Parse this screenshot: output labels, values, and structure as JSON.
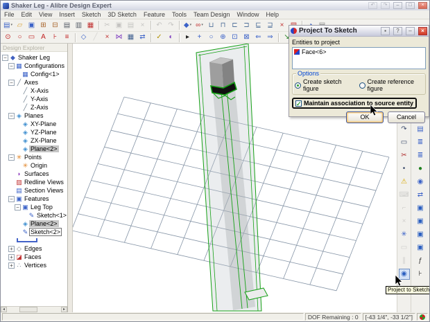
{
  "window": {
    "title": "Shaker Leg - Alibre Design Expert",
    "buttons": {
      "back": "↶",
      "forward": "↷",
      "minimize": "–",
      "maximize": "□",
      "close": "×"
    }
  },
  "menu": {
    "items": [
      "File",
      "Edit",
      "View",
      "Insert",
      "Sketch",
      "3D Sketch",
      "Feature",
      "Tools",
      "Team Design",
      "Window",
      "Help"
    ]
  },
  "toolbars": {
    "row1": [
      [
        {
          "name": "new-part-button",
          "glyph": "▤",
          "color": "#3b62c8",
          "dropdown": true
        },
        {
          "name": "open-button",
          "glyph": "▱",
          "color": "#d9a33c"
        },
        {
          "name": "save-button",
          "glyph": "▣",
          "color": "#3b62c8"
        },
        {
          "name": "import-button",
          "glyph": "⊞",
          "color": "#a8652c"
        },
        {
          "name": "export-button",
          "glyph": "⊟",
          "color": "#a8652c"
        },
        {
          "name": "print-button",
          "glyph": "▤",
          "color": "#555c66"
        },
        {
          "name": "print-preview-button",
          "glyph": "▥",
          "color": "#555c66"
        },
        {
          "name": "publish-report-button",
          "glyph": "▦",
          "color": "#c03030"
        }
      ],
      [
        {
          "name": "cut-button",
          "glyph": "✂",
          "color": "#666",
          "disabled": true
        },
        {
          "name": "copy-button",
          "glyph": "▣",
          "color": "#666",
          "disabled": true
        },
        {
          "name": "paste-button",
          "glyph": "▤",
          "color": "#666",
          "disabled": true
        },
        {
          "name": "delete-button",
          "glyph": "×",
          "color": "#666",
          "disabled": true
        }
      ],
      [
        {
          "name": "undo-button",
          "glyph": "↶",
          "color": "#666",
          "disabled": true
        },
        {
          "name": "redo-button",
          "glyph": "↷",
          "color": "#666",
          "disabled": true
        }
      ],
      [
        {
          "name": "view-cube-button",
          "glyph": "◆",
          "color": "#3b62c8",
          "dropdown": true
        },
        {
          "name": "measure-button",
          "glyph": "∞",
          "color": "#c03030",
          "dropdown": true
        },
        {
          "name": "view-orientation-front-button",
          "glyph": "⊔",
          "color": "#50709a"
        },
        {
          "name": "view-orientation-back-button",
          "glyph": "⊓",
          "color": "#50709a"
        },
        {
          "name": "view-orientation-left-button",
          "glyph": "⊏",
          "color": "#50709a"
        },
        {
          "name": "view-orientation-right-button",
          "glyph": "⊐",
          "color": "#50709a"
        },
        {
          "name": "view-orientation-top-button",
          "glyph": "⊑",
          "color": "#50709a"
        },
        {
          "name": "view-orientation-bottom-button",
          "glyph": "⊒",
          "color": "#50709a"
        },
        {
          "name": "remove-view-button",
          "glyph": "×",
          "color": "#c03030"
        },
        {
          "name": "annotation-views-button",
          "glyph": "▨",
          "color": "#c03030"
        }
      ],
      [
        {
          "name": "design-explorer-toggle-button",
          "glyph": "◑",
          "color": "#3b62c8"
        },
        {
          "name": "options-button",
          "glyph": "▤",
          "color": "#888"
        }
      ]
    ],
    "row2": [
      [
        {
          "name": "sketch-select-tool",
          "glyph": "⊙",
          "color": "#c02020"
        },
        {
          "name": "ellipse-tool",
          "glyph": "○",
          "color": "#c02020"
        },
        {
          "name": "rectangle-annotation-tool",
          "glyph": "▭",
          "color": "#c02020"
        },
        {
          "name": "text-tool",
          "glyph": "A",
          "color": "#c02020"
        },
        {
          "name": "dimension-annotation-tool",
          "glyph": "⊦",
          "color": "#c02020"
        },
        {
          "name": "line-format-tool",
          "glyph": "≡",
          "color": "#c02020"
        }
      ],
      [
        {
          "name": "insert-plane-button",
          "glyph": "◇",
          "color": "#3b62c8"
        },
        {
          "name": "insert-axis-button",
          "glyph": "╱",
          "color": "#999",
          "disabled": true
        },
        {
          "name": "erase-tool",
          "glyph": "×",
          "color": "#c03030"
        },
        {
          "name": "mirror-tool",
          "glyph": "⋈",
          "color": "#8040c0"
        },
        {
          "name": "design-table-button",
          "glyph": "▦",
          "color": "#406090"
        },
        {
          "name": "move-tool",
          "glyph": "⇄",
          "color": "#3b62c8"
        }
      ],
      [
        {
          "name": "check-design-button",
          "glyph": "✓",
          "color": "#b09000"
        },
        {
          "name": "scale-tool",
          "glyph": "◐",
          "color": "#8040c0"
        }
      ],
      [
        {
          "name": "select-cursor-tool",
          "glyph": "▸",
          "color": "#222"
        },
        {
          "name": "pan-tool",
          "glyph": "+",
          "color": "#3b62c8"
        },
        {
          "name": "orbit-tool",
          "glyph": "○",
          "color": "#3b62c8"
        },
        {
          "name": "zoom-in-tool",
          "glyph": "⊕",
          "color": "#3b62c8"
        },
        {
          "name": "zoom-window-tool",
          "glyph": "⊡",
          "color": "#3b62c8"
        },
        {
          "name": "zoom-fit-tool",
          "glyph": "⊠",
          "color": "#3b62c8"
        },
        {
          "name": "previous-view-button",
          "glyph": "⇐",
          "color": "#3b62c8"
        },
        {
          "name": "next-view-button",
          "glyph": "⇒",
          "color": "#3b62c8"
        }
      ],
      [
        {
          "name": "rotate-view-ccw-button",
          "glyph": "↘",
          "color": "#208020"
        },
        {
          "name": "rotate-view-cw-button",
          "glyph": "↗",
          "color": "#c03030"
        }
      ],
      [
        {
          "name": "global-viewing-button",
          "glyph": "●",
          "color": "#2060c0"
        }
      ]
    ],
    "right_sketch": [
      [
        {
          "name": "select-sketch-tool",
          "glyph": "▸",
          "color": "#3a4a6b"
        },
        {
          "name": "line-sketch-tool",
          "glyph": "╱",
          "color": "#3a4a6b"
        },
        {
          "name": "polyline-sketch-tool",
          "glyph": "╭",
          "color": "#3a4a6b"
        },
        {
          "name": "spline-sketch-tool",
          "glyph": "∿",
          "color": "#3a4a6b"
        },
        {
          "name": "point-reference-tool",
          "glyph": "·",
          "color": "#3a4a6b"
        },
        {
          "name": "circle-sketch-tool",
          "glyph": "⊙",
          "color": "#3a4a6b"
        },
        {
          "name": "arc-sketch-tool",
          "glyph": "↷",
          "color": "#3a4a6b",
          "dropdown": true
        },
        {
          "name": "rectangle-sketch-tool",
          "glyph": "▭",
          "color": "#3a4a6b",
          "dropdown": true
        },
        {
          "name": "trim-sketch-tool",
          "glyph": "✂",
          "color": "#b03030",
          "dropdown": true
        },
        {
          "name": "point-sketch-tool",
          "glyph": "•",
          "color": "#3a4a6b",
          "dropdown": true
        },
        {
          "name": "sketch-analysis-warning-button",
          "glyph": "⚠",
          "color": "#d8a800",
          "dropdown": true
        },
        {
          "name": "keyboard-entry-button",
          "glyph": "⌨",
          "color": "#888",
          "disabled": true
        },
        {
          "name": "fillet-sketch-tool",
          "glyph": "⌐",
          "color": "#888",
          "disabled": true
        },
        {
          "name": "chamfer-sketch-tool",
          "glyph": "×",
          "color": "#888",
          "disabled": true
        },
        {
          "name": "pattern-sketch-tool",
          "glyph": "✳",
          "color": "#3b62c8",
          "dropdown": true
        },
        {
          "name": "mirror-sketch-tool",
          "glyph": "▭",
          "color": "#888",
          "disabled": true
        },
        {
          "name": "offset-sketch-tool",
          "glyph": "∥",
          "color": "#888",
          "disabled": true
        },
        {
          "name": "project-to-sketch-button",
          "glyph": "◉",
          "color": "#2b5fc0",
          "pressed": true
        }
      ]
    ],
    "right_feature": [
      [
        {
          "name": "activate-part-button",
          "glyph": "◆",
          "color": "#3b62c8"
        },
        {
          "name": "new-sketch-button",
          "glyph": "✎",
          "color": "#3b62c8"
        },
        {
          "name": "new-3d-sketch-button",
          "glyph": "✎",
          "color": "#208020"
        },
        {
          "name": "sketch-properties-button",
          "glyph": "▤",
          "color": "#3b62c8"
        },
        {
          "name": "redline-button",
          "glyph": "▨",
          "color": "#c03030"
        },
        {
          "name": "check-sketch-button",
          "glyph": "✓",
          "color": "#208020"
        },
        {
          "name": "sketch-notebook-button",
          "glyph": "▤",
          "color": "#3b62c8"
        },
        {
          "name": "extrude-boss-button",
          "glyph": "≣",
          "color": "#3b62c8"
        },
        {
          "name": "extrude-cut-button",
          "glyph": "≣",
          "color": "#3b62c8"
        },
        {
          "name": "revolve-boss-button",
          "glyph": "●",
          "color": "#208020",
          "dropdown": true
        },
        {
          "name": "revolve-cut-button",
          "glyph": "◉",
          "color": "#3b62c8"
        },
        {
          "name": "sweep-button",
          "glyph": "⇄",
          "color": "#3b62c8"
        },
        {
          "name": "loft-button",
          "glyph": "▣",
          "color": "#2b5fc0"
        },
        {
          "name": "shell-button",
          "glyph": "▣",
          "color": "#2b5fc0"
        },
        {
          "name": "draft-button",
          "glyph": "▣",
          "color": "#2b5fc0"
        },
        {
          "name": "pattern-feature-button",
          "glyph": "▣",
          "color": "#2b5fc0"
        },
        {
          "name": "equation-editor-button",
          "glyph": "ƒ",
          "color": "#333"
        },
        {
          "name": "dimension-tool-button",
          "glyph": "⊦",
          "color": "#333",
          "dropdown": true
        }
      ]
    ]
  },
  "design_explorer": {
    "header": "Design Explorer",
    "tree": [
      {
        "label": "Shaker Leg",
        "level": 0,
        "expander": "minus",
        "icon": {
          "name": "part-icon",
          "glyph": "◆",
          "color": "#4060c0"
        }
      },
      {
        "label": "Configurations",
        "level": 1,
        "expander": "minus",
        "icon": {
          "name": "configurations-icon",
          "glyph": "▦",
          "color": "#3b62c8"
        }
      },
      {
        "label": "Config<1>",
        "level": 2,
        "expander": null,
        "icon": {
          "name": "configuration-icon",
          "glyph": "▦",
          "color": "#3b62c8"
        }
      },
      {
        "label": "Axes",
        "level": 1,
        "expander": "minus",
        "icon": {
          "name": "axis-icon",
          "glyph": "╱",
          "color": "#708090"
        }
      },
      {
        "label": "X-Axis",
        "level": 2,
        "expander": null,
        "icon": {
          "name": "axis-icon",
          "glyph": "╱",
          "color": "#708090"
        }
      },
      {
        "label": "Y-Axis",
        "level": 2,
        "expander": null,
        "icon": {
          "name": "axis-icon",
          "glyph": "╱",
          "color": "#708090"
        }
      },
      {
        "label": "Z-Axis",
        "level": 2,
        "expander": null,
        "icon": {
          "name": "axis-icon",
          "glyph": "╱",
          "color": "#708090"
        }
      },
      {
        "label": "Planes",
        "level": 1,
        "expander": "minus",
        "icon": {
          "name": "plane-icon",
          "glyph": "◈",
          "color": "#3f8fd0"
        }
      },
      {
        "label": "XY-Plane",
        "level": 2,
        "expander": null,
        "icon": {
          "name": "plane-icon",
          "glyph": "◈",
          "color": "#3f8fd0"
        }
      },
      {
        "label": "YZ-Plane",
        "level": 2,
        "expander": null,
        "icon": {
          "name": "plane-icon",
          "glyph": "◈",
          "color": "#3f8fd0"
        }
      },
      {
        "label": "ZX-Plane",
        "level": 2,
        "expander": null,
        "icon": {
          "name": "plane-icon",
          "glyph": "◈",
          "color": "#3f8fd0"
        }
      },
      {
        "label": "Plane<2>",
        "level": 2,
        "expander": null,
        "selected": true,
        "icon": {
          "name": "plane-icon",
          "glyph": "◈",
          "color": "#3f8fd0"
        }
      },
      {
        "label": "Points",
        "level": 1,
        "expander": "minus",
        "icon": {
          "name": "point-icon",
          "glyph": "✳",
          "color": "#e08020"
        }
      },
      {
        "label": "Origin",
        "level": 2,
        "expander": null,
        "icon": {
          "name": "origin-icon",
          "glyph": "✳",
          "color": "#e08020"
        }
      },
      {
        "label": "Surfaces",
        "level": 1,
        "expander": null,
        "icon": {
          "name": "surfaces-icon",
          "glyph": "◗",
          "color": "#9040c0"
        }
      },
      {
        "label": "Redline Views",
        "level": 1,
        "expander": null,
        "icon": {
          "name": "redline-views-icon",
          "glyph": "▨",
          "color": "#c03030"
        }
      },
      {
        "label": "Section Views",
        "level": 1,
        "expander": null,
        "icon": {
          "name": "section-views-icon",
          "glyph": "▤",
          "color": "#3b62c8"
        }
      },
      {
        "label": "Features",
        "level": 1,
        "expander": "minus",
        "icon": {
          "name": "features-icon",
          "glyph": "▣",
          "color": "#3b62c8"
        }
      },
      {
        "label": "Leg Top",
        "level": 2,
        "expander": "minus",
        "icon": {
          "name": "feature-icon",
          "glyph": "▣",
          "color": "#3b62c8"
        }
      },
      {
        "label": "Sketch<1>",
        "level": 3,
        "expander": null,
        "icon": {
          "name": "sketch-icon",
          "glyph": "✎",
          "color": "#3b62c8"
        }
      },
      {
        "label": "Plane<2>",
        "level": 2,
        "expander": null,
        "selected": true,
        "icon": {
          "name": "plane-icon",
          "glyph": "◈",
          "color": "#3f8fd0"
        }
      },
      {
        "label": "Sketch<2>",
        "level": 2,
        "expander": null,
        "boxed": true,
        "icon": {
          "name": "sketch-icon",
          "glyph": "✎",
          "color": "#3b62c8"
        }
      },
      {
        "label": "",
        "level": 1,
        "expander": null,
        "marker": true,
        "icon": {
          "name": "end-of-features-marker",
          "glyph": "",
          "color": "#4262c8"
        }
      },
      {
        "label": "Edges",
        "level": 1,
        "expander": "plus",
        "icon": {
          "name": "edges-icon",
          "glyph": "◇",
          "color": "#808080"
        }
      },
      {
        "label": "Faces",
        "level": 1,
        "expander": "plus",
        "icon": {
          "name": "faces-icon",
          "glyph": "◪",
          "color": "#c03030"
        }
      },
      {
        "label": "Vertices",
        "level": 1,
        "expander": "plus",
        "icon": {
          "name": "vertices-icon",
          "glyph": "∴",
          "color": "#708090"
        }
      }
    ]
  },
  "dialog": {
    "title": "Project To Sketch",
    "entities_label": "Entities to project",
    "entities": [
      {
        "label": "Face<6>"
      }
    ],
    "options_label": "Options",
    "radio_sketch": "Create sketch figure",
    "radio_reference": "Create reference figure",
    "checkbox_label": "Maintain association to source entity",
    "ok_label": "OK",
    "cancel_label": "Cancel"
  },
  "tooltip": {
    "text": "Project to Sketch"
  },
  "status_bar": {
    "dof": "DOF Remaining : 0",
    "coords": "[-43 1/4\", -33 1/2\"]"
  },
  "colors": {
    "sketch_green": "#15a015",
    "selection_gray": "#c6c6c6",
    "tooltip_bg": "#ffffe1",
    "groupbox_label_blue": "#0046d5",
    "radio_check_green": "#2ba12b",
    "close_red": "#cf3a24"
  }
}
